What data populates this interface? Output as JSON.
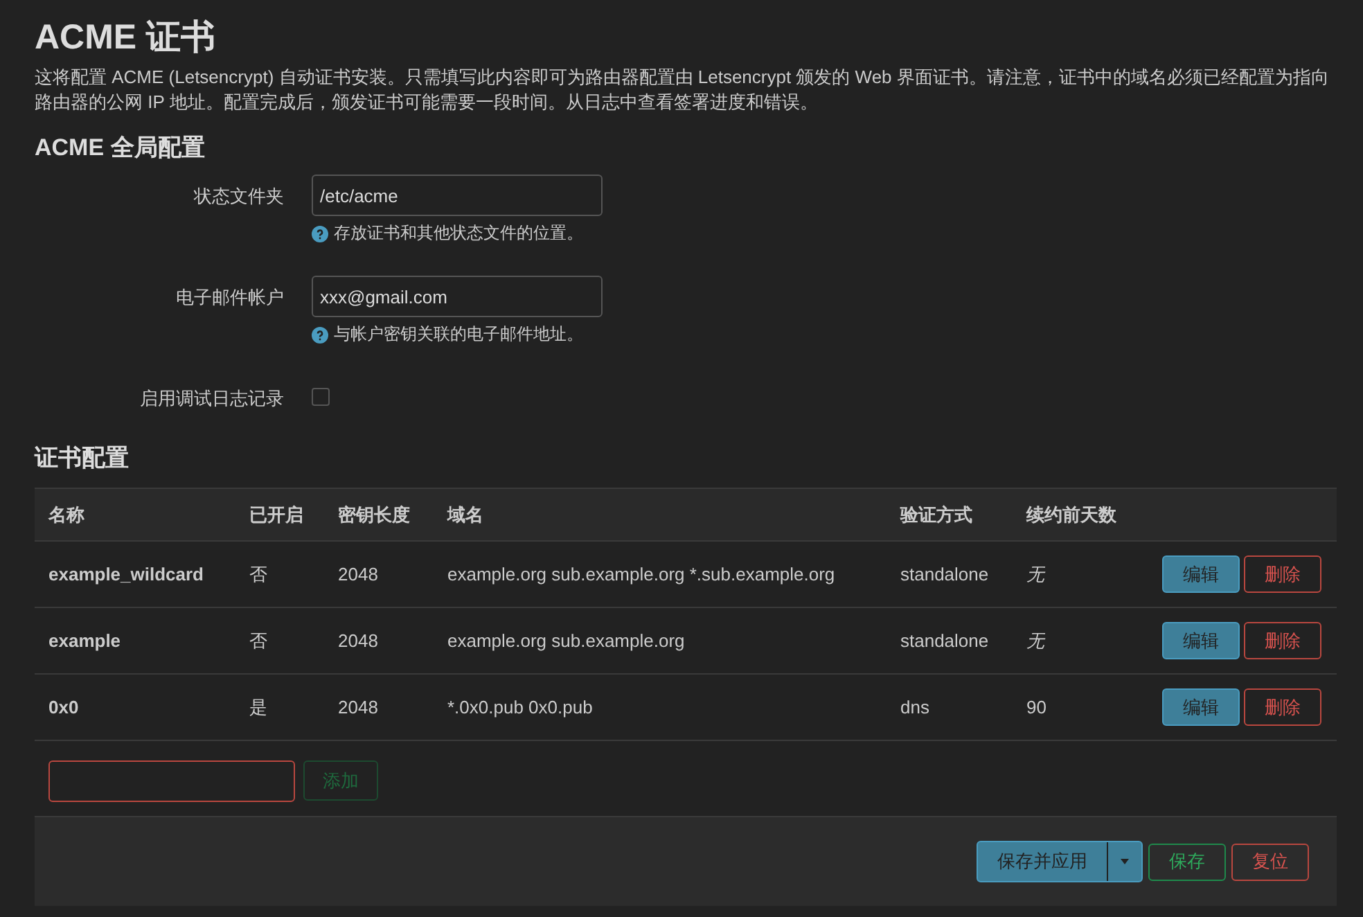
{
  "title": "ACME 证书",
  "description": "这将配置 ACME (Letsencrypt) 自动证书安装。只需填写此内容即可为路由器配置由 Letsencrypt 颁发的 Web 界面证书。请注意，证书中的域名必须已经配置为指向路由器的公网 IP 地址。配置完成后，颁发证书可能需要一段时间。从日志中查看签署进度和错误。",
  "global_section": {
    "heading": "ACME 全局配置",
    "fields": [
      {
        "kind": "text",
        "label": "状态文件夹",
        "value": "/etc/acme",
        "help": "存放证书和其他状态文件的位置。"
      },
      {
        "kind": "text",
        "label": "电子邮件帐户",
        "value": "xxx@gmail.com",
        "help": "与帐户密钥关联的电子邮件地址。"
      },
      {
        "kind": "checkbox",
        "label": "启用调试日志记录",
        "checked": false
      }
    ]
  },
  "cert_section": {
    "heading": "证书配置",
    "columns": [
      "名称",
      "已开启",
      "密钥长度",
      "域名",
      "验证方式",
      "续约前天数"
    ],
    "rows": [
      {
        "name": "example_wildcard",
        "enabled": "否",
        "key_length": "2048",
        "domains": "example.org sub.example.org *.sub.example.org",
        "validation": "standalone",
        "renew": "无",
        "renew_is_default": true,
        "edit": "编辑",
        "delete": "删除"
      },
      {
        "name": "example",
        "enabled": "否",
        "key_length": "2048",
        "domains": "example.org sub.example.org",
        "validation": "standalone",
        "renew": "无",
        "renew_is_default": true,
        "edit": "编辑",
        "delete": "删除"
      },
      {
        "name": "0x0",
        "enabled": "是",
        "key_length": "2048",
        "domains": "*.0x0.pub 0x0.pub",
        "validation": "dns",
        "renew": "90",
        "renew_is_default": false,
        "edit": "编辑",
        "delete": "删除"
      }
    ],
    "add_button": {
      "label": "添加",
      "disabled": true
    }
  },
  "footer": {
    "save_apply": "保存并应用",
    "save": "保存",
    "reset": "复位"
  }
}
